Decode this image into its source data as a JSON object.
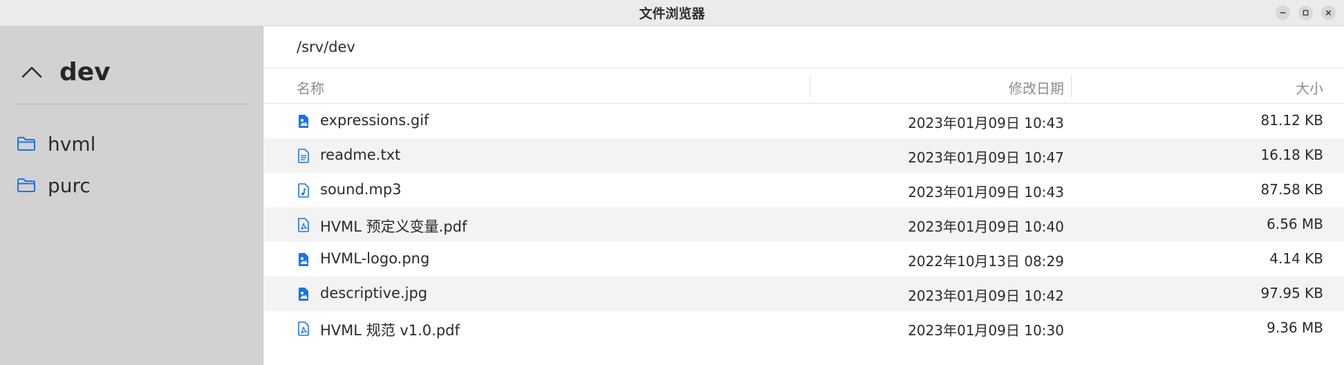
{
  "window": {
    "title": "文件浏览器",
    "controls": [
      "minimize-icon",
      "maximize-icon",
      "close-icon"
    ]
  },
  "sidebar": {
    "header": {
      "icon": "chevron-up-icon",
      "label": "dev"
    },
    "items": [
      {
        "label": "hvml",
        "icon": "folder-icon"
      },
      {
        "label": "purc",
        "icon": "folder-icon"
      }
    ]
  },
  "main": {
    "path": "/srv/dev",
    "columns": {
      "name": "名称",
      "modified": "修改日期",
      "size": "大小"
    },
    "files": [
      {
        "name": "expressions.gif",
        "modified": "2023年01月09日 10:43",
        "size": "81.12 KB",
        "icon": "image-file-icon"
      },
      {
        "name": "readme.txt",
        "modified": "2023年01月09日 10:47",
        "size": "16.18 KB",
        "icon": "text-file-icon"
      },
      {
        "name": "sound.mp3",
        "modified": "2023年01月09日 10:43",
        "size": "87.58 KB",
        "icon": "audio-file-icon"
      },
      {
        "name": "HVML 预定义变量.pdf",
        "modified": "2023年01月09日 10:40",
        "size": "6.56 MB",
        "icon": "pdf-file-icon"
      },
      {
        "name": "HVML-logo.png",
        "modified": "2022年10月13日 08:29",
        "size": "4.14 KB",
        "icon": "image-file-icon"
      },
      {
        "name": "descriptive.jpg",
        "modified": "2023年01月09日 10:42",
        "size": "97.95 KB",
        "icon": "image-file-icon"
      },
      {
        "name": "HVML 规范 v1.0.pdf",
        "modified": "2023年01月09日 10:30",
        "size": "9.36 MB",
        "icon": "pdf-file-icon"
      }
    ]
  },
  "colors": {
    "accent": "#1a73e8",
    "sidebar_bg": "#d2d2d2",
    "titlebar_bg": "#ebebeb",
    "row_alt_bg": "#f3f3f3"
  }
}
